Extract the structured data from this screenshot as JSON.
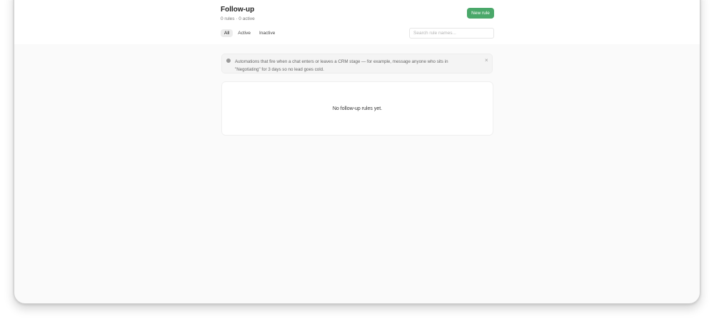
{
  "header": {
    "title": "Follow-up",
    "subtitle": "0 rules · 0 active",
    "new_rule_label": "New rule"
  },
  "filters": {
    "tabs": [
      {
        "label": "All",
        "active": true
      },
      {
        "label": "Active",
        "active": false
      },
      {
        "label": "Inactive",
        "active": false
      }
    ]
  },
  "search": {
    "placeholder": "Search rule names...",
    "value": ""
  },
  "banner": {
    "icon": "info-icon",
    "text": "Automations that fire when a chat enters or leaves a CRM stage — for example, message anyone who sits in \"Negotiating\" for 3 days so no lead goes cold.",
    "close_icon": "×"
  },
  "empty_state": {
    "text": "No follow-up rules yet."
  },
  "colors": {
    "accent": "#4aa86a",
    "background": "#fafafa"
  }
}
